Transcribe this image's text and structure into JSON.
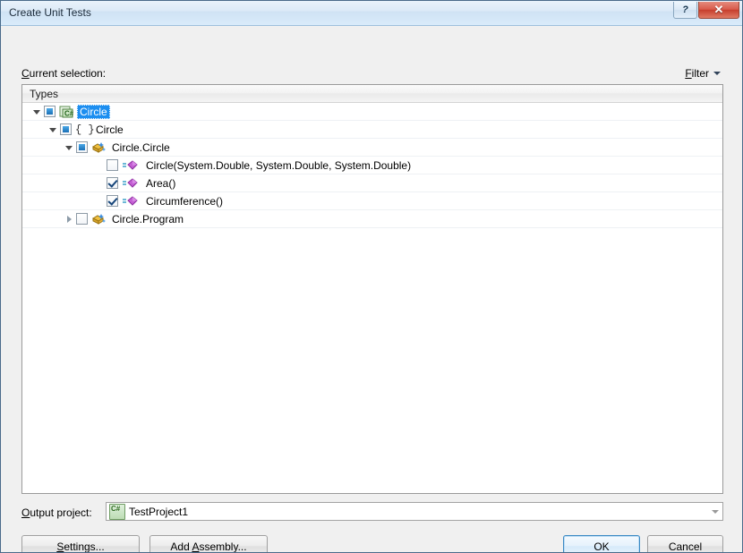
{
  "window": {
    "title": "Create Unit Tests",
    "help_button_glyph": "?",
    "close_button_glyph": "✕"
  },
  "header": {
    "current_selection_label_prefix": "C",
    "current_selection_label_rest": "urrent selection:",
    "filter_label": "Filter"
  },
  "tree": {
    "column_header": "Types",
    "rows": [
      {
        "label": "Circle",
        "indent": 0,
        "twisty": "expanded",
        "checkbox": "indeterminate",
        "icon": "csharp-project-icon",
        "selected": true
      },
      {
        "label": "Circle",
        "indent": 1,
        "twisty": "expanded",
        "checkbox": "indeterminate",
        "icon": "namespace-icon",
        "icon_glyph": "{ }",
        "selected": false
      },
      {
        "label": "Circle.Circle",
        "indent": 2,
        "twisty": "expanded",
        "checkbox": "indeterminate",
        "icon": "class-icon",
        "selected": false
      },
      {
        "label": "Circle(System.Double, System.Double, System.Double)",
        "indent": 3,
        "twisty": "none",
        "checkbox": "unchecked",
        "icon": "method-icon",
        "selected": false
      },
      {
        "label": "Area()",
        "indent": 3,
        "twisty": "none",
        "checkbox": "checked",
        "icon": "method-icon",
        "selected": false
      },
      {
        "label": "Circumference()",
        "indent": 3,
        "twisty": "none",
        "checkbox": "checked",
        "icon": "method-icon",
        "selected": false
      },
      {
        "label": "Circle.Program",
        "indent": 2,
        "twisty": "collapsed",
        "checkbox": "unchecked",
        "icon": "class-icon",
        "selected": false
      }
    ]
  },
  "output_project": {
    "label_prefix": "O",
    "label_rest": "utput project:",
    "value": "TestProject1",
    "icon": "csharp-project-icon"
  },
  "buttons": {
    "settings_prefix": "S",
    "settings_rest": "ettings...",
    "add_assembly_pre": "Add ",
    "add_assembly_acc": "A",
    "add_assembly_rest": "ssembly...",
    "ok": "OK",
    "cancel": "Cancel"
  },
  "colors": {
    "selection_blue": "#1c8ef0",
    "default_button_border": "#3c8ac4",
    "close_button_red": "#c63d2c",
    "method_icon_purple": "#b14fc4",
    "class_icon_gold": "#e8b23a"
  }
}
